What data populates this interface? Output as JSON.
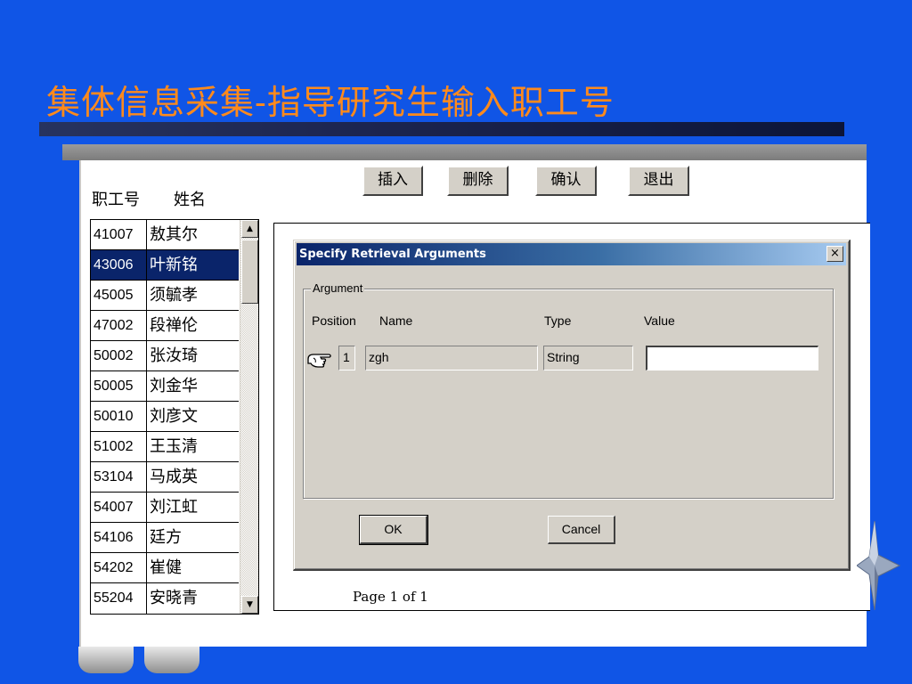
{
  "slide": {
    "title": "集体信息采集-指导研究生输入职工号"
  },
  "toolbar": {
    "insert_label": "插入",
    "delete_label": "删除",
    "confirm_label": "确认",
    "exit_label": "退出"
  },
  "list": {
    "col_id": "职工号",
    "col_name": "姓名",
    "selected_index": 1,
    "rows": [
      {
        "id": "41007",
        "name": "敖其尔"
      },
      {
        "id": "43006",
        "name": "叶新铭"
      },
      {
        "id": "45005",
        "name": "须毓孝"
      },
      {
        "id": "47002",
        "name": "段禅伦"
      },
      {
        "id": "50002",
        "name": "张汝琦"
      },
      {
        "id": "50005",
        "name": "刘金华"
      },
      {
        "id": "50010",
        "name": "刘彦文"
      },
      {
        "id": "51002",
        "name": "王玉清"
      },
      {
        "id": "53104",
        "name": "马成英"
      },
      {
        "id": "54007",
        "name": "刘江虹"
      },
      {
        "id": "54106",
        "name": "廷方"
      },
      {
        "id": "54202",
        "name": "崔健"
      },
      {
        "id": "55204",
        "name": "安晓青"
      }
    ]
  },
  "report": {
    "page_label": "Page 1 of 1"
  },
  "dialog": {
    "title": "Specify Retrieval Arguments",
    "close_glyph": "×",
    "group_label": "Argument",
    "headers": {
      "position": "Position",
      "name": "Name",
      "type": "Type",
      "value": "Value"
    },
    "argument": {
      "position": "1",
      "name": "zgh",
      "type": "String",
      "value": ""
    },
    "ok_label": "OK",
    "cancel_label": "Cancel"
  },
  "colors": {
    "background": "#1055e6",
    "title": "#ff8a1c",
    "selection": "#0a246a"
  }
}
